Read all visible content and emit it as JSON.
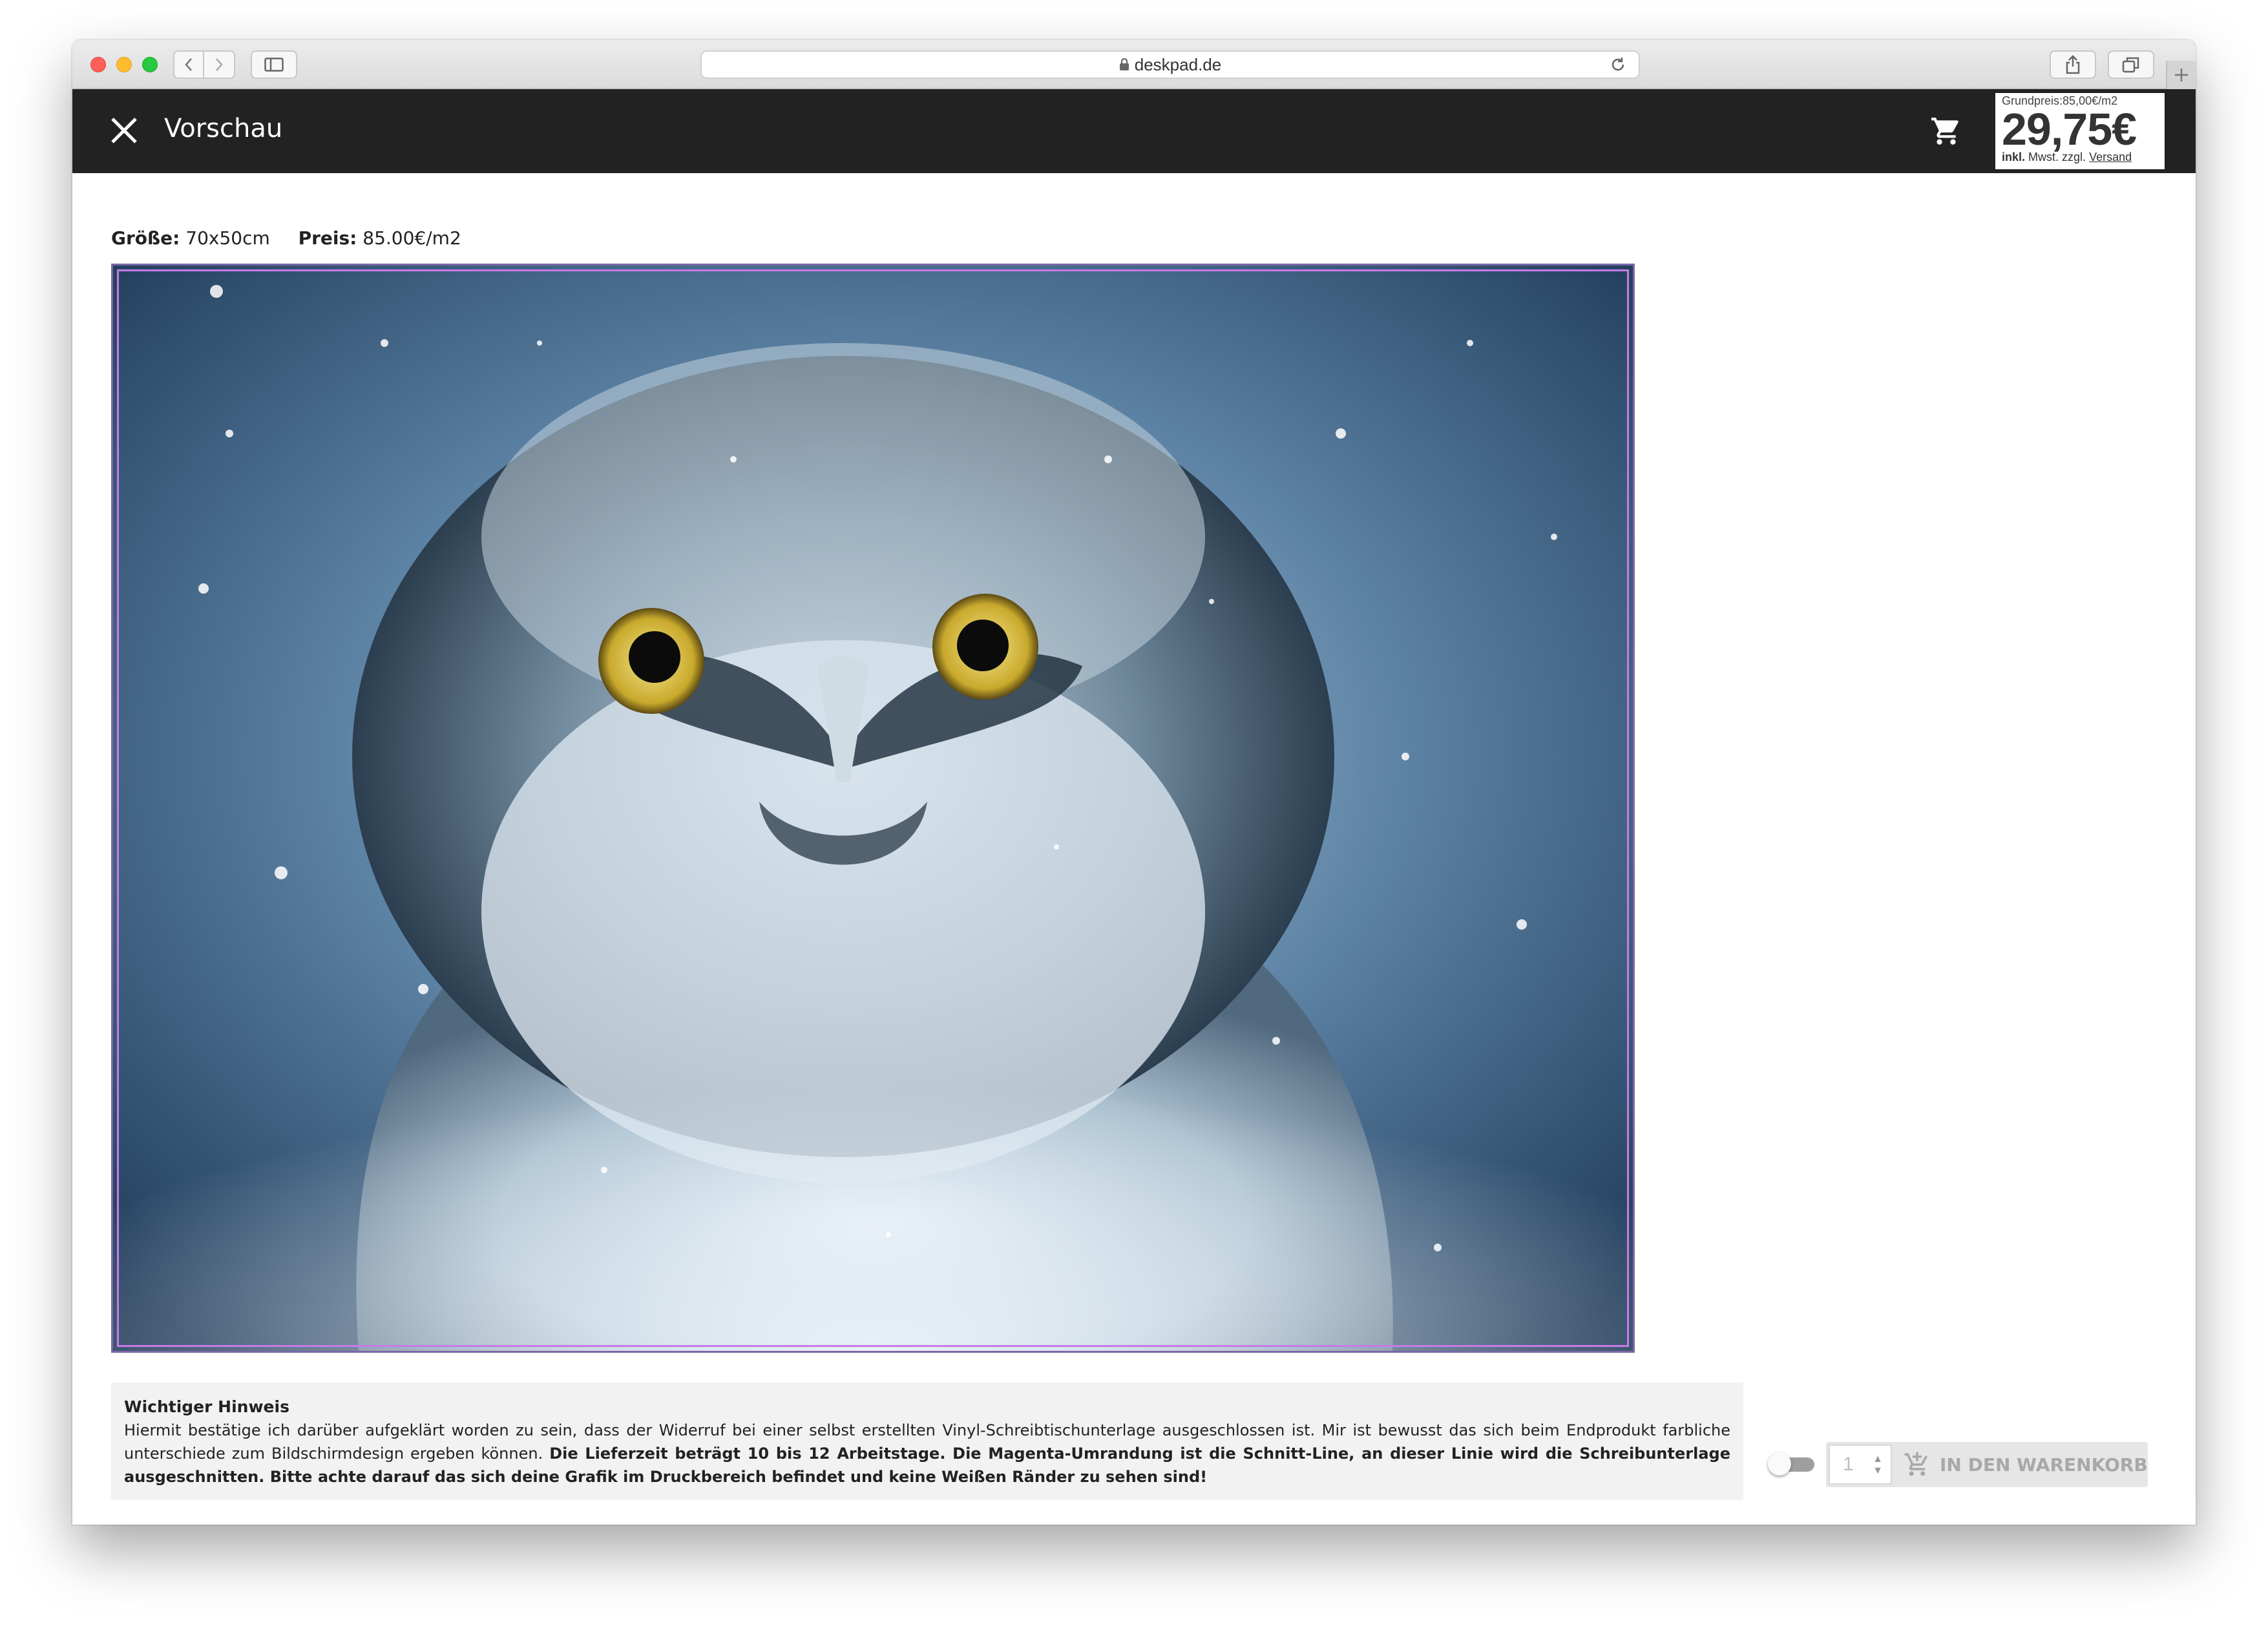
{
  "browser": {
    "url": "deskpad.de"
  },
  "appbar": {
    "title": "Vorschau",
    "price_box": {
      "base_price": "Grundpreis:85,00€/m2",
      "price": "29,75€",
      "incl": "inkl.",
      "vat": "Mwst. zzgl.",
      "shipping_link": "Versand"
    }
  },
  "info": {
    "size_label": "Größe:",
    "size_value": "70x50cm",
    "price_label": "Preis:",
    "price_value": "85.00€/m2"
  },
  "preview": {
    "subject": "snow owl photo",
    "cut_line_color": "#c77ae8"
  },
  "notice": {
    "title": "Wichtiger Hinweis",
    "text_regular": "Hiermit bestätige ich darüber aufgeklärt worden zu sein, dass der Widerruf bei einer selbst erstellten Vinyl-Schreibtischunterlage ausgeschlossen ist. Mir ist bewusst das sich beim Endprodukt farbliche unterschiede zum Bildschirmdesign ergeben können.",
    "text_bold": "Die Lieferzeit beträgt 10 bis 12 Arbeitstage. Die Magenta-Umrandung ist die Schnitt-Line, an dieser Linie wird die Schreibunterlage ausgeschnitten. Bitte achte darauf das sich deine Grafik im Druckbereich befindet und keine Weißen Ränder zu sehen sind!"
  },
  "cart": {
    "quantity": "1",
    "add_label": "IN DEN WARENKORB",
    "toggle_state": "off"
  },
  "icons": {
    "close": "close-icon",
    "cart": "cart-icon",
    "add_to_cart": "add-cart-icon",
    "lock": "lock-icon",
    "reload": "reload-icon"
  }
}
